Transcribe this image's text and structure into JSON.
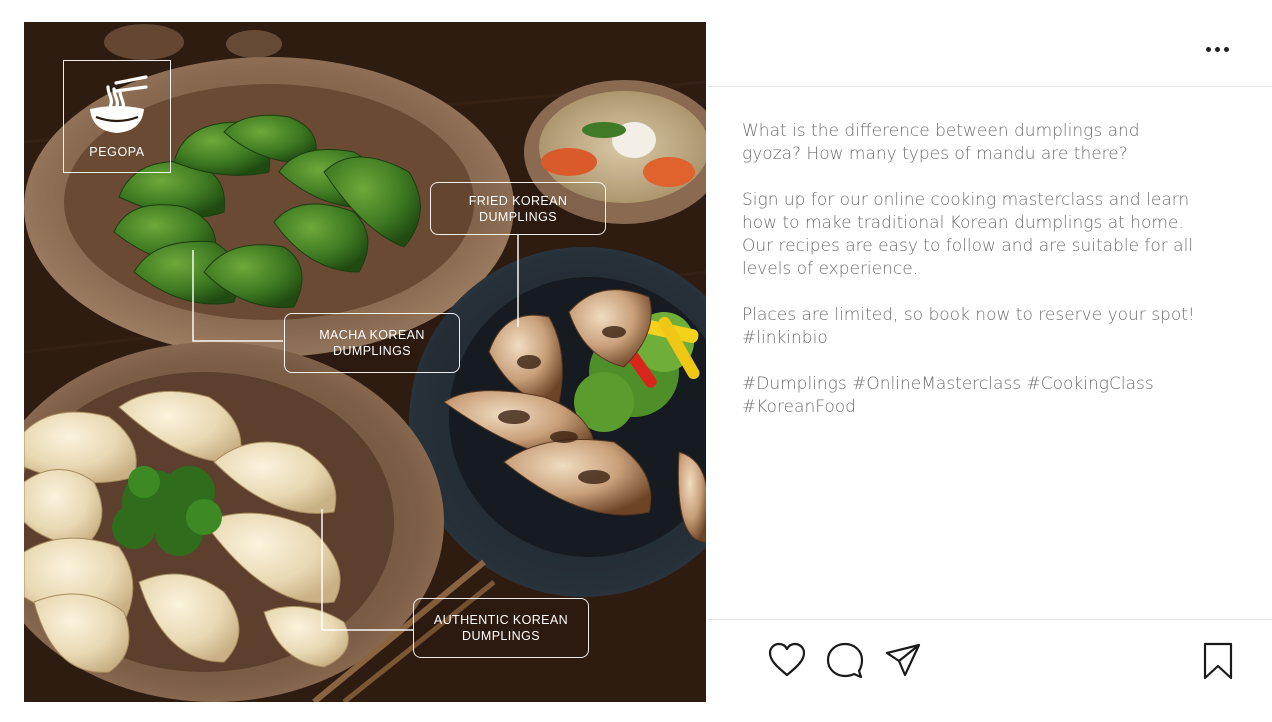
{
  "post": {
    "brand": "PEGOPA",
    "callouts": {
      "fried": [
        "FRIED KOREAN",
        "DUMPLINGS"
      ],
      "macha": [
        "MACHA KOREAN",
        "DUMPLINGS"
      ],
      "authentic": [
        "AUTHENTIC KOREAN",
        "DUMPLINGS"
      ]
    },
    "caption": {
      "p1": "What is the difference between dumplings and\ngyoza? How many types of mandu are there?",
      "p2": "Sign up for our online cooking masterclass and learn\nhow to make traditional Korean dumplings at home.\nOur recipes are easy to follow and are suitable for all\nlevels of experience.",
      "p3": "Places are limited, so book now to reserve your spot!\n#linkinbio",
      "p4": "#Dumplings #OnlineMasterclass #CookingClass\n#KoreanFood"
    }
  },
  "icons": {
    "more": "more-horizontal-icon",
    "like": "heart-icon",
    "comment": "comment-icon",
    "share": "send-icon",
    "save": "bookmark-icon",
    "logo": "noodle-bowl-icon"
  },
  "colors": {
    "caption_text": "#6f6f6f",
    "icon_stroke": "#1a1a1a",
    "divider": "#e3e3e3"
  }
}
